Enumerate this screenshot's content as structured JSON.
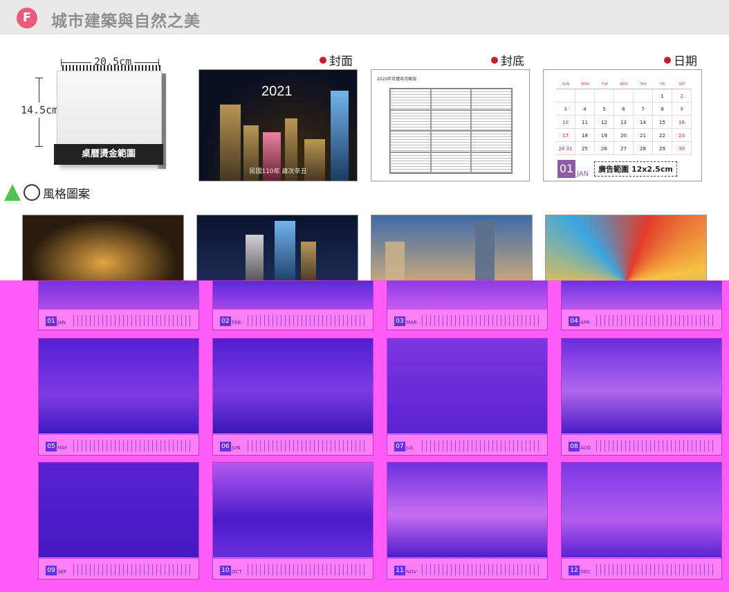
{
  "header": {
    "badge": "F",
    "title": "城市建築與自然之美"
  },
  "desk": {
    "width_label": "20.5cm",
    "height_label": "14.5cm",
    "band_label": "桌曆燙金範圍"
  },
  "previews": {
    "cover": {
      "label": "封面",
      "year": "2021",
      "subtitle": "民國110年 歲次辛丑"
    },
    "back": {
      "label": "封底",
      "table_title": "2020年月曆各月解說"
    },
    "date": {
      "label": "日期",
      "weekdays": [
        "SUN",
        "MON",
        "TUE",
        "WED",
        "THU",
        "FRI",
        "SAT"
      ],
      "days": [
        "",
        "",
        "",
        "",
        "",
        "1",
        "2",
        "3",
        "4",
        "5",
        "6",
        "7",
        "8",
        "9",
        "10",
        "11",
        "12",
        "13",
        "14",
        "15",
        "16",
        "17",
        "18",
        "19",
        "20",
        "21",
        "22",
        "23",
        "24 31",
        "25",
        "26",
        "27",
        "28",
        "29",
        "30"
      ],
      "month_num": "01",
      "month_name": "JAN",
      "ad_label": "廣告範圍 12x2.5cm"
    }
  },
  "style": {
    "label": "風格圖案"
  },
  "months": [
    {
      "num": "01",
      "name": "JAN"
    },
    {
      "num": "02",
      "name": "FEB"
    },
    {
      "num": "03",
      "name": "MAR"
    },
    {
      "num": "04",
      "name": "APR"
    },
    {
      "num": "05",
      "name": "MAY"
    },
    {
      "num": "06",
      "name": "JUN"
    },
    {
      "num": "07",
      "name": "JUL"
    },
    {
      "num": "08",
      "name": "AUG"
    },
    {
      "num": "09",
      "name": "SEP"
    },
    {
      "num": "10",
      "name": "OCT"
    },
    {
      "num": "11",
      "name": "NOV"
    },
    {
      "num": "12",
      "name": "DEC"
    }
  ]
}
